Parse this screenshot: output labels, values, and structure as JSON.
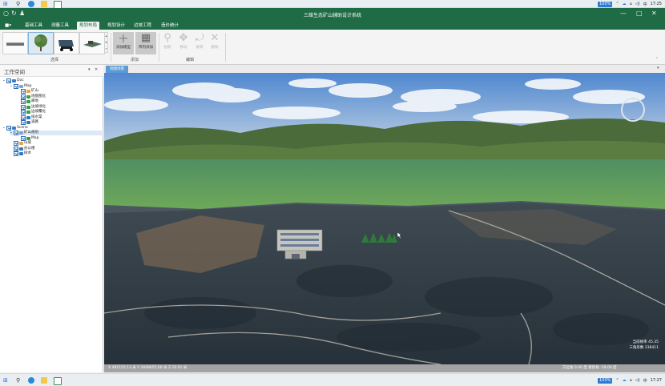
{
  "taskbar": {
    "time": "17:25",
    "time_bottom": "17:27",
    "battery": "100%",
    "ime": "中",
    "ime2": "中"
  },
  "window": {
    "title": "三维生态矿山辅助设计系统",
    "minimize": "—",
    "maximize": "□",
    "close": "✕"
  },
  "menu": {
    "app_button": "■▾",
    "tabs": [
      "基础工具",
      "测量工具",
      "规划布局",
      "规划设计",
      "边坡工程",
      "造价统计"
    ],
    "active_index": 2
  },
  "ribbon": {
    "select_group_label": "选择",
    "add_group_label": "添加",
    "edit_group_label": "编辑",
    "add_buttons": [
      {
        "label": "添加模型",
        "icon": "plus-icon"
      },
      {
        "label": "阵列添加",
        "icon": "grid-icon"
      }
    ],
    "edit_buttons": [
      {
        "label": "拾取",
        "icon": "pick-icon"
      },
      {
        "label": "移动",
        "icon": "move-icon"
      },
      {
        "label": "旋转",
        "icon": "rotate-icon"
      },
      {
        "label": "删除",
        "icon": "delete-icon"
      }
    ],
    "thumbnails": [
      "long-block-model",
      "tree-model",
      "truck-model",
      "machine-model"
    ]
  },
  "workspace": {
    "title": "工作空间",
    "pin": "▾",
    "close": "✕",
    "tree": [
      {
        "label": "Doc",
        "level": 0,
        "expand": "⌄",
        "color": "#3a7fc8"
      },
      {
        "label": "Map",
        "level": 1,
        "expand": "⌄",
        "color": "#7fa5cf"
      },
      {
        "label": "矿山",
        "level": 2,
        "expand": "",
        "color": "#e8a640"
      },
      {
        "label": "地貌图化",
        "level": 2,
        "expand": "",
        "color": "#3c9a4a"
      },
      {
        "label": "耕地",
        "level": 2,
        "expand": "",
        "color": "#3c9a4a"
      },
      {
        "label": "边坡绿化",
        "level": 2,
        "expand": "",
        "color": "#3c9a4a"
      },
      {
        "label": "边坡覆化",
        "level": 2,
        "expand": "",
        "color": "#3c9a4a"
      },
      {
        "label": "排水渠",
        "level": 2,
        "expand": "",
        "color": "#2f78c6"
      },
      {
        "label": "道路",
        "level": 2,
        "expand": "",
        "color": "#2f78c6"
      },
      {
        "label": "Scene",
        "level": 0,
        "expand": "⌄",
        "color": "#3a7fc8"
      },
      {
        "label": "矿山规划",
        "level": 1,
        "expand": "⌄",
        "color": "#7fa5cf",
        "selected": true
      },
      {
        "label": "Map",
        "level": 2,
        "expand": "",
        "color": "#3c9a4a"
      },
      {
        "label": "山坡",
        "level": 1,
        "expand": "",
        "color": "#e8a640"
      },
      {
        "label": "办公楼",
        "level": 1,
        "expand": "",
        "color": "#2f78c6"
      },
      {
        "label": "树木",
        "level": 1,
        "expand": "",
        "color": "#2f78c6"
      }
    ]
  },
  "viewport": {
    "tab_label": "地图场景",
    "dropdown": "▾",
    "status_coords": "X 491152.13 米  Y 3449655.00 米  Z 10.01 米",
    "frame_rate": "当前帧率 45.35",
    "triangles": "三角形数 238411",
    "direction": "方位角 0.00 度  俯仰角 -18.00 度"
  },
  "colors": {
    "accent": "#1e6b45",
    "tab_blue": "#5b9bd5",
    "sky": "#6f9ed8",
    "terrain": "#35424f"
  }
}
